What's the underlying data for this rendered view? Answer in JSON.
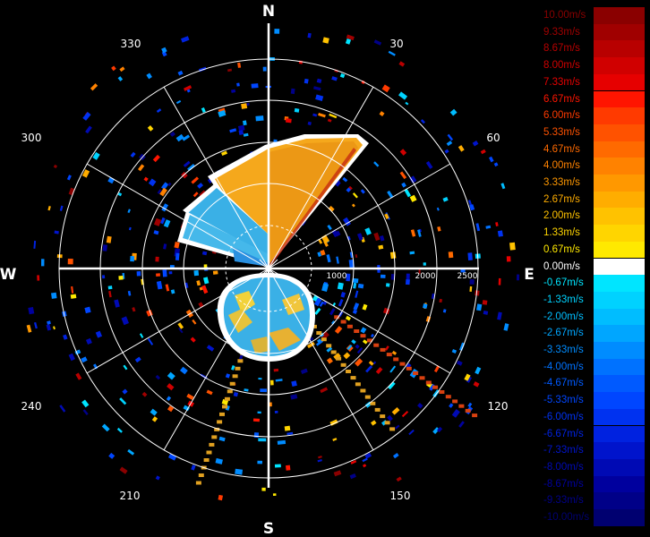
{
  "compass": {
    "north": "N",
    "south": "S",
    "east": "E",
    "west": "W"
  },
  "bearings": [
    "30",
    "60",
    "120",
    "150",
    "210",
    "240",
    "300",
    "330"
  ],
  "range_labels": [
    "1000",
    "2000",
    "2500"
  ],
  "legend": [
    {
      "label": "10.00m/s",
      "color": "#8a0000"
    },
    {
      "label": "9.33m/s",
      "color": "#a00000"
    },
    {
      "label": "8.67m/s",
      "color": "#b80000"
    },
    {
      "label": "8.00m/s",
      "color": "#d00000"
    },
    {
      "label": "7.33m/s",
      "color": "#e60000"
    },
    {
      "label": "6.67m/s",
      "color": "#ff1500"
    },
    {
      "label": "6.00m/s",
      "color": "#ff3a00"
    },
    {
      "label": "5.33m/s",
      "color": "#ff5200"
    },
    {
      "label": "4.67m/s",
      "color": "#ff6a00"
    },
    {
      "label": "4.00m/s",
      "color": "#ff8200"
    },
    {
      "label": "3.33m/s",
      "color": "#ff9800"
    },
    {
      "label": "2.67m/s",
      "color": "#ffad00"
    },
    {
      "label": "2.00m/s",
      "color": "#ffc200"
    },
    {
      "label": "1.33m/s",
      "color": "#ffd500"
    },
    {
      "label": "0.67m/s",
      "color": "#ffe900"
    },
    {
      "label": "0.00m/s",
      "color": "#ffffff"
    },
    {
      "label": "-0.67m/s",
      "color": "#00e5ff"
    },
    {
      "label": "-1.33m/s",
      "color": "#00d2ff"
    },
    {
      "label": "-2.00m/s",
      "color": "#00bdff"
    },
    {
      "label": "-2.67m/s",
      "color": "#00a6ff"
    },
    {
      "label": "-3.33m/s",
      "color": "#008cff"
    },
    {
      "label": "-4.00m/s",
      "color": "#0072ff"
    },
    {
      "label": "-4.67m/s",
      "color": "#005aff"
    },
    {
      "label": "-5.33m/s",
      "color": "#0046ff"
    },
    {
      "label": "-6.00m/s",
      "color": "#0032f0"
    },
    {
      "label": "-6.67m/s",
      "color": "#0022e0"
    },
    {
      "label": "-7.33m/s",
      "color": "#0014cc"
    },
    {
      "label": "-8.00m/s",
      "color": "#000ab4"
    },
    {
      "label": "-8.67m/s",
      "color": "#00009e"
    },
    {
      "label": "-9.33m/s",
      "color": "#000088"
    },
    {
      "label": "-10.00m/s",
      "color": "#000070"
    }
  ]
}
